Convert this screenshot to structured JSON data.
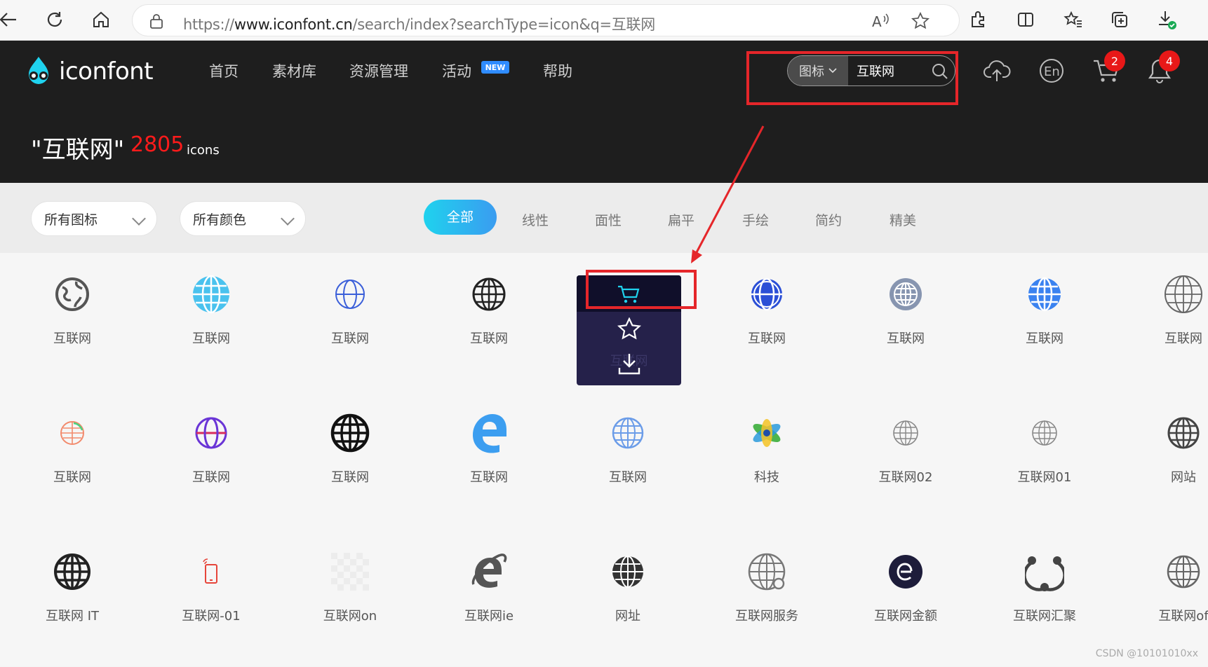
{
  "browser": {
    "url_prefix": "https://",
    "url_domain": "www.iconfont.cn",
    "url_path": "/search/index?searchType=icon&q=互联网"
  },
  "header": {
    "logo_text": "iconfont",
    "nav": [
      "首页",
      "素材库",
      "资源管理",
      "活动",
      "帮助"
    ],
    "new_badge": "NEW",
    "search_type": "图标",
    "search_value": "互联网",
    "cart_count": "2",
    "notice_count": "4",
    "lang_label": "En"
  },
  "result": {
    "query": "\"互联网\"",
    "count": "2805",
    "unit": "icons"
  },
  "filters": {
    "icon_select": "所有图标",
    "color_select": "所有颜色",
    "styles": [
      "全部",
      "线性",
      "面性",
      "扁平",
      "手绘",
      "简约",
      "精美"
    ]
  },
  "icons": [
    {
      "name": "互联网",
      "icon": "earth-outline-icon"
    },
    {
      "name": "互联网",
      "icon": "globe-lightblue-icon"
    },
    {
      "name": "互联网",
      "icon": "globe-outline-blue-icon"
    },
    {
      "name": "互联网",
      "icon": "globe-black-grid-icon"
    },
    {
      "name": "互联网",
      "icon": "hovered-icon"
    },
    {
      "name": "互联网",
      "icon": "globe-royalblue-icon"
    },
    {
      "name": "互联网",
      "icon": "globe-grey-icon"
    },
    {
      "name": "互联网",
      "icon": "globe-blue-icon"
    },
    {
      "name": "互联网",
      "icon": "globe-thin-icon"
    },
    {
      "name": "互联网",
      "icon": "globe-salmon-icon"
    },
    {
      "name": "互联网",
      "icon": "globe-purple-icon"
    },
    {
      "name": "互联网",
      "icon": "globe-bold-icon"
    },
    {
      "name": "互联网",
      "icon": "edge-e-icon"
    },
    {
      "name": "互联网",
      "icon": "globe-light-icon"
    },
    {
      "name": "科技",
      "icon": "atom-icon"
    },
    {
      "name": "互联网02",
      "icon": "globe-small-grey-icon"
    },
    {
      "name": "互联网01",
      "icon": "globe-small-grey-icon"
    },
    {
      "name": "网站",
      "icon": "globe-darkgrey-icon"
    },
    {
      "name": "互联网 IT",
      "icon": "globe-black-icon"
    },
    {
      "name": "互联网-01",
      "icon": "phone-signal-icon"
    },
    {
      "name": "互联网on",
      "icon": "placeholder-icon"
    },
    {
      "name": "互联网ie",
      "icon": "ie-icon"
    },
    {
      "name": "网址",
      "icon": "globe-dark-icon"
    },
    {
      "name": "互联网服务",
      "icon": "globe-service-icon"
    },
    {
      "name": "互联网金额",
      "icon": "ecoin-icon"
    },
    {
      "name": "互联网汇聚",
      "icon": "network-hub-icon"
    },
    {
      "name": "互联网of",
      "icon": "globe-thin-grey-icon"
    }
  ],
  "hover_actions": [
    "cart-icon",
    "star-icon",
    "download-icon"
  ],
  "watermark": "CSDN @10101010xx",
  "colors": {
    "accent": "#1fd2ee",
    "highlight": "#e5262a",
    "count_red": "#ff1b1b"
  }
}
